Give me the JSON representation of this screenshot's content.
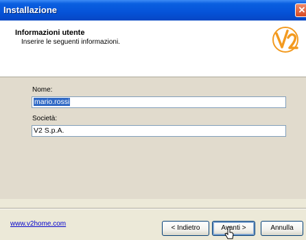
{
  "window": {
    "title": "Installazione",
    "close_glyph": "✕"
  },
  "header": {
    "title": "Informazioni utente",
    "subtitle": "Inserire le seguenti informazioni.",
    "logo_icon": "v2-logo-icon"
  },
  "form": {
    "name_label": "Nome:",
    "name_value": "mario.rossi",
    "company_label": "Società:",
    "company_value": "V2  S.p.A."
  },
  "footer": {
    "link": "www.v2home.com",
    "back_label": "< Indietro",
    "next_label": "Avanti >",
    "cancel_label": "Annulla"
  },
  "colors": {
    "accent": "#0553d8",
    "selection": "#316ac5",
    "link": "#0000cc"
  }
}
